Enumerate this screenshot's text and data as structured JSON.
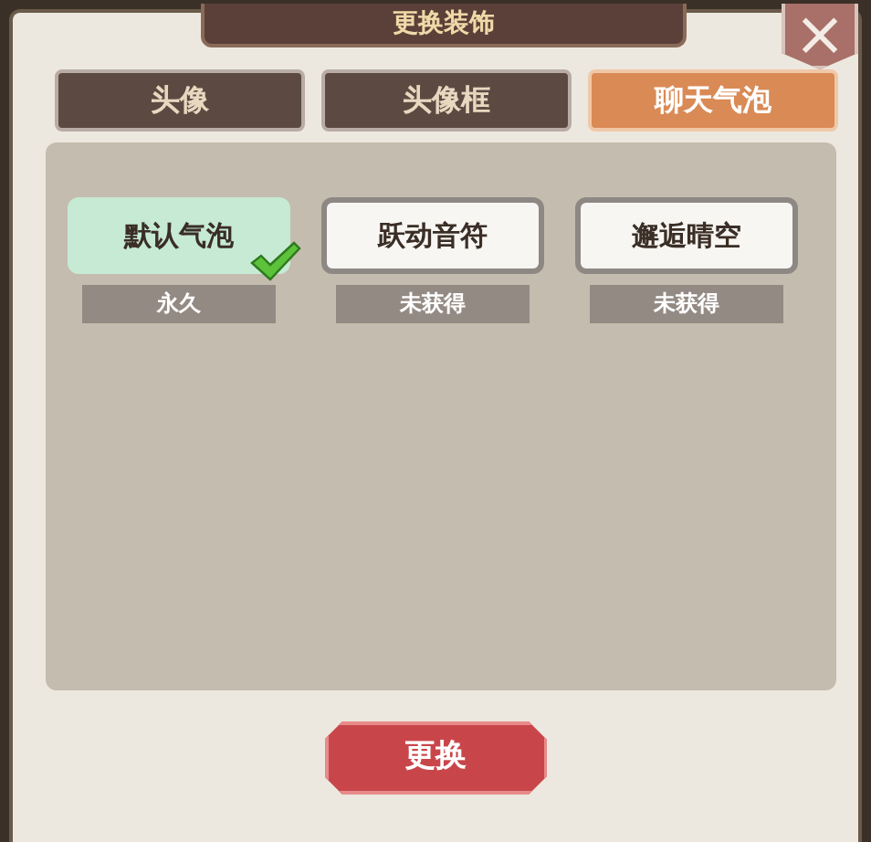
{
  "window": {
    "title": "更换装饰",
    "close": "×"
  },
  "tabs": [
    {
      "label": "头像",
      "selected": false
    },
    {
      "label": "头像框",
      "selected": false
    },
    {
      "label": "聊天气泡",
      "selected": true
    }
  ],
  "bubbles": [
    {
      "name": "默认气泡",
      "status": "永久",
      "selected": true
    },
    {
      "name": "跃动音符",
      "status": "未获得",
      "selected": false
    },
    {
      "name": "邂逅晴空",
      "status": "未获得",
      "selected": false
    }
  ],
  "button": "更换"
}
